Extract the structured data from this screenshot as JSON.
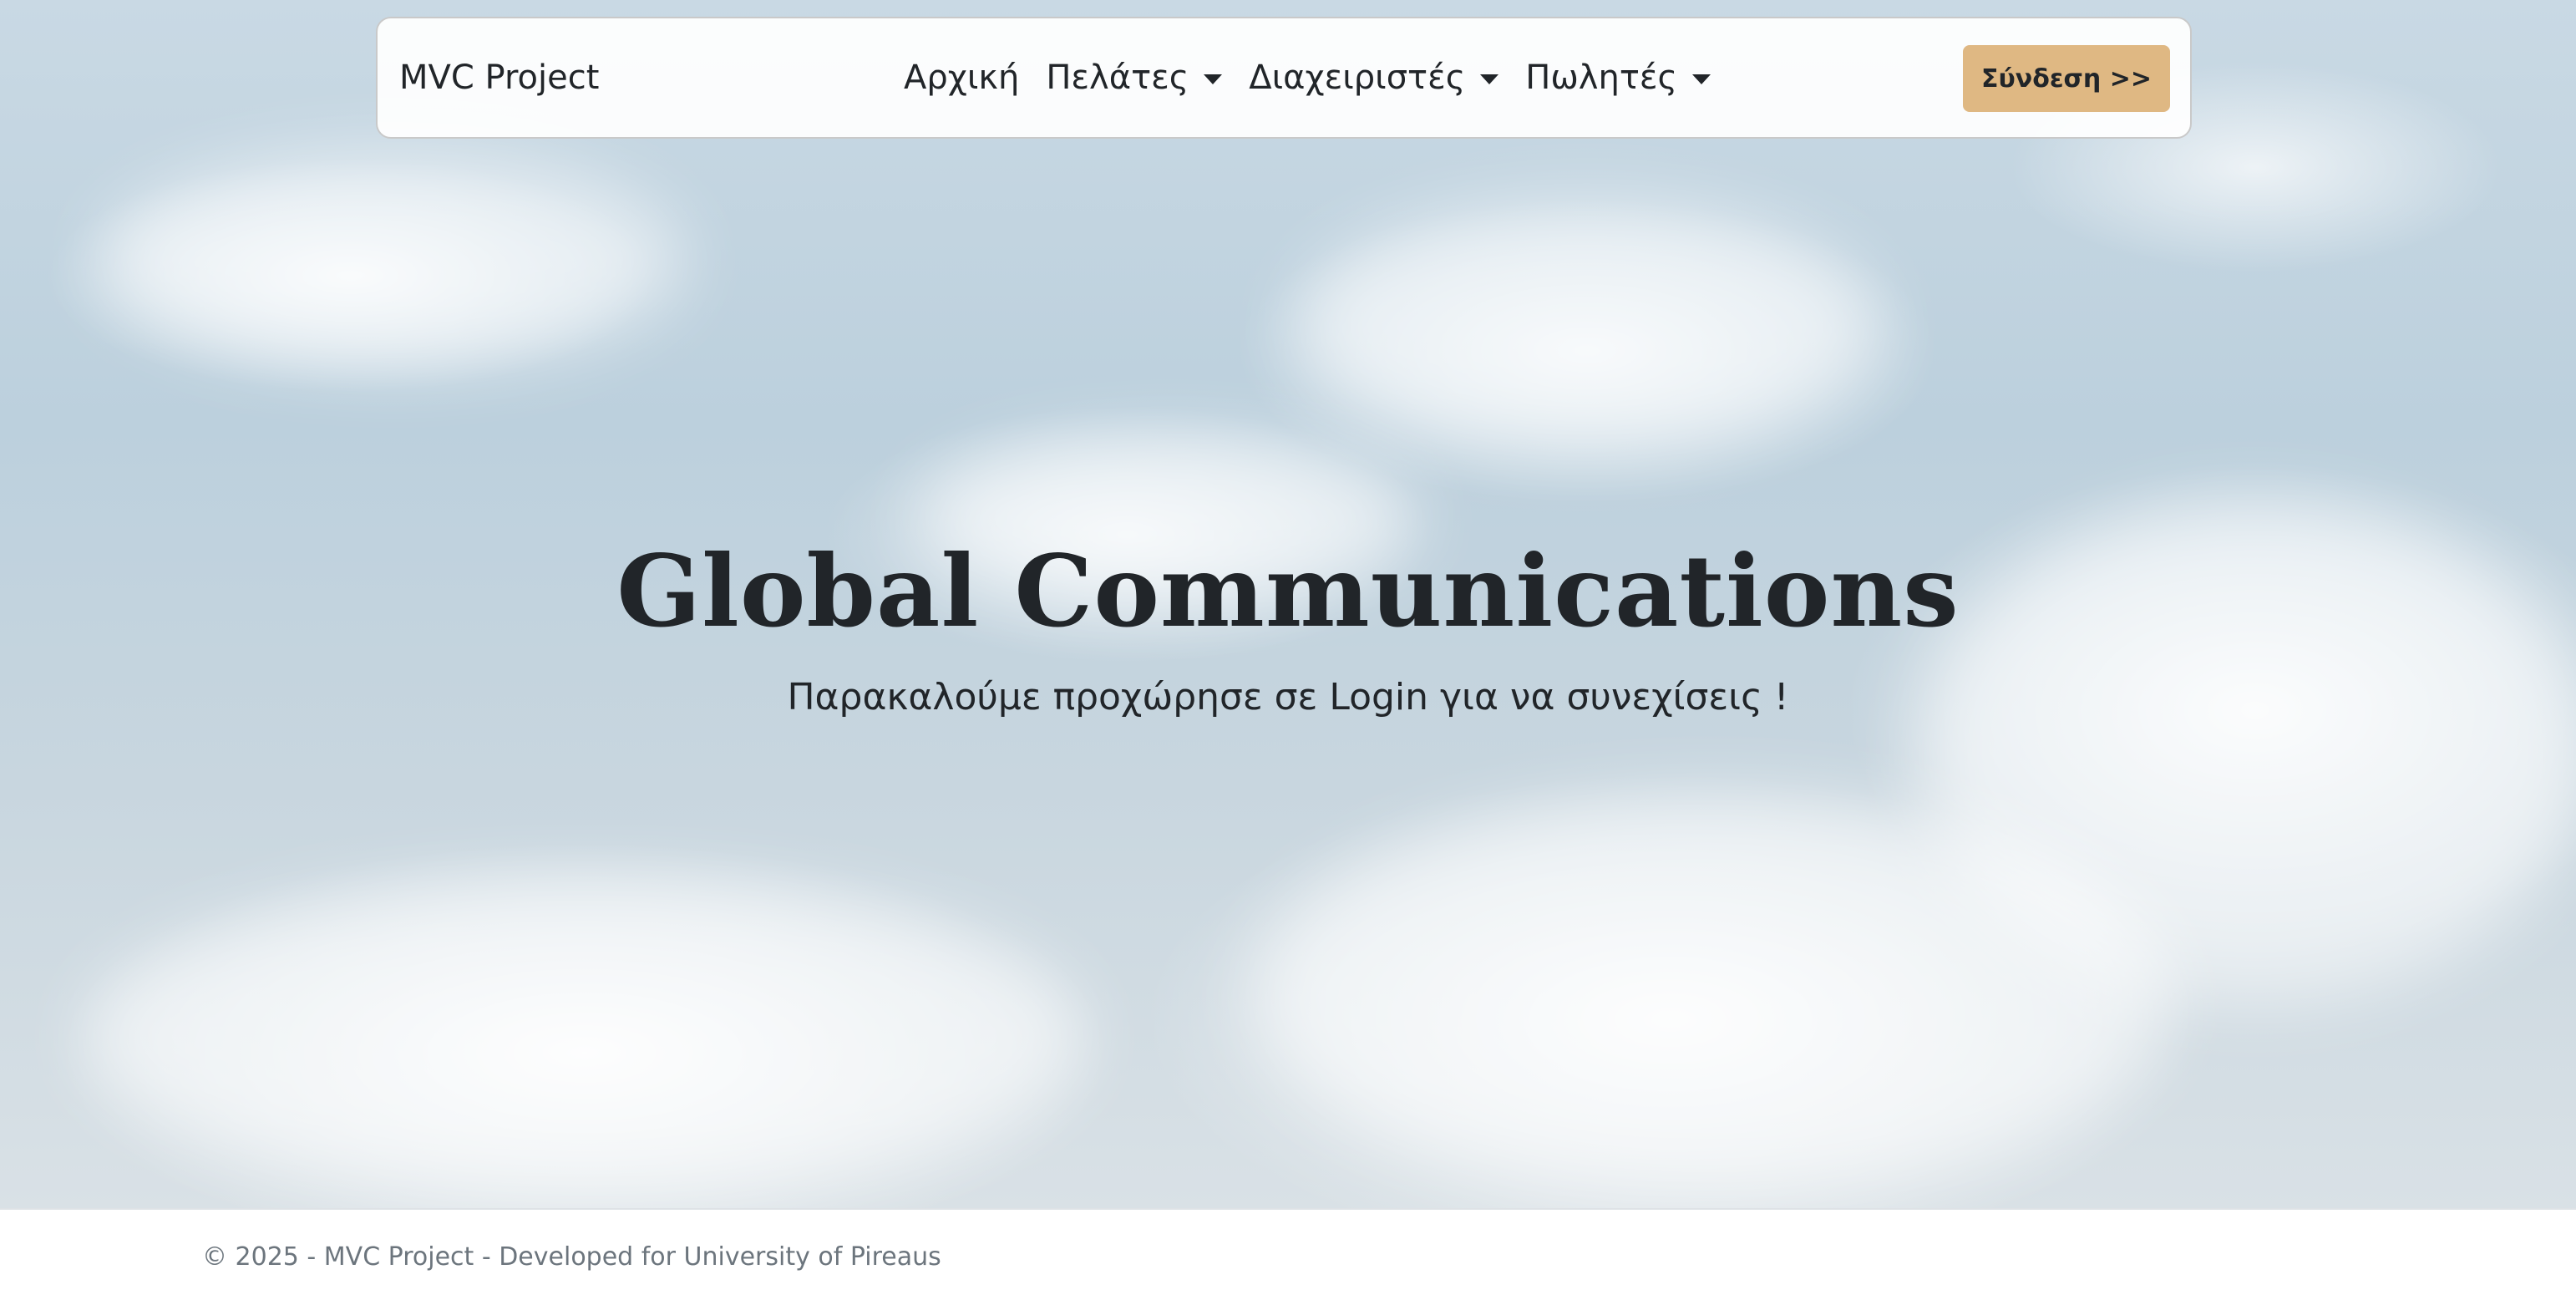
{
  "navbar": {
    "brand": "MVC Project",
    "links": [
      {
        "label": "Αρχική",
        "dropdown": false
      },
      {
        "label": "Πελάτες",
        "dropdown": true
      },
      {
        "label": "Διαχειριστές",
        "dropdown": true
      },
      {
        "label": "Πωλητές",
        "dropdown": true
      }
    ],
    "login_label": "Σύνδεση >>"
  },
  "hero": {
    "title": "Global Communications",
    "subtitle": "Παρακαλούμε προχώρησε σε Login για να συνεχίσεις !"
  },
  "footer": {
    "text": "© 2025 - MVC Project - Developed for University of Pireaus"
  },
  "colors": {
    "login_button": "#dfb883",
    "text": "#212529",
    "footer_text": "#6c757d"
  }
}
